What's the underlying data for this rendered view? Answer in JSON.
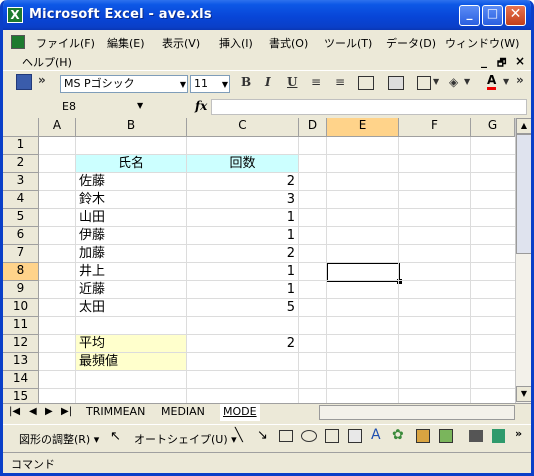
{
  "window": {
    "title": "Microsoft Excel - ave.xls",
    "app_icon": "excel-icon",
    "controls": {
      "minimize": "_",
      "maximize": "□",
      "close": "✕"
    }
  },
  "menu": {
    "items": [
      "ファイル(F)",
      "編集(E)",
      "表示(V)",
      "挿入(I)",
      "書式(O)",
      "ツール(T)",
      "データ(D)",
      "ウィンドウ(W)",
      "ヘルプ(H)"
    ],
    "doc_controls": {
      "minimize": "_",
      "restore": "🗗",
      "close": "×"
    }
  },
  "toolbar": {
    "font_name": "MS Pゴシック",
    "font_size": "11",
    "bold": "B",
    "italic": "I",
    "underline": "U",
    "chevron": "»"
  },
  "formula_bar": {
    "name_box": "E8",
    "fx": "fx",
    "formula": ""
  },
  "grid": {
    "columns": [
      "A",
      "B",
      "C",
      "D",
      "E",
      "F",
      "G"
    ],
    "rows": [
      "1",
      "2",
      "3",
      "4",
      "5",
      "6",
      "7",
      "8",
      "9",
      "10",
      "11",
      "12",
      "13",
      "14",
      "15"
    ],
    "selected_column": "E",
    "selected_row": "8",
    "header": {
      "name": "氏名",
      "count": "回数"
    },
    "data": [
      {
        "name": "佐藤",
        "count": "2"
      },
      {
        "name": "鈴木",
        "count": "3"
      },
      {
        "name": "山田",
        "count": "1"
      },
      {
        "name": "伊藤",
        "count": "1"
      },
      {
        "name": "加藤",
        "count": "2"
      },
      {
        "name": "井上",
        "count": "1"
      },
      {
        "name": "近藤",
        "count": "1"
      },
      {
        "name": "太田",
        "count": "5"
      }
    ],
    "summary": [
      {
        "label": "平均",
        "value": "2"
      },
      {
        "label": "最頻値",
        "value": ""
      }
    ],
    "colors": {
      "header_fill": "#ccffff",
      "summary_fill": "#ffffcc",
      "selected_header": "#ffd38a"
    }
  },
  "sheets": {
    "nav": [
      "|◀",
      "◀",
      "▶",
      "▶|"
    ],
    "tabs": [
      "TRIMMEAN",
      "MEDIAN",
      "MODE"
    ],
    "active": "MODE"
  },
  "drawing_toolbar": {
    "draw_menu": "図形の調整(R) ▾",
    "autoshapes": "オートシェイプ(U) ▾"
  },
  "status": {
    "text": "コマンド"
  }
}
